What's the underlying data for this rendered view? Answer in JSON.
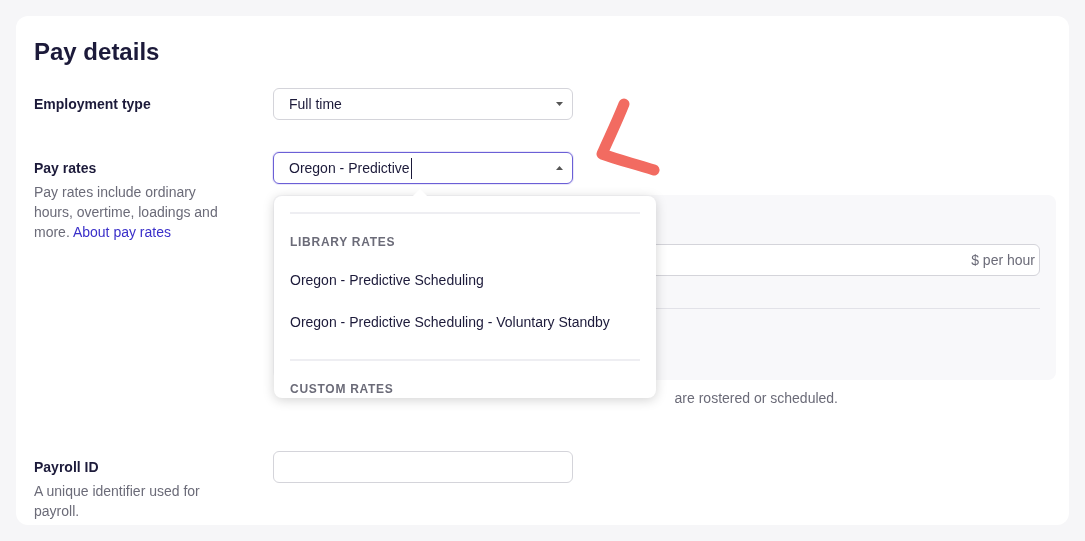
{
  "title": "Pay details",
  "employment_type": {
    "label": "Employment type",
    "value": "Full time"
  },
  "pay_rates": {
    "label": "Pay rates",
    "description": "Pay rates include ordinary hours, overtime, loadings and more.",
    "link": "About pay rates",
    "value": "Oregon - Predictive",
    "expanded": true,
    "panel": {
      "rate_suffix": "$ per hour"
    },
    "area_note": "are rostered or scheduled.",
    "dropdown": {
      "groups": [
        {
          "heading": "LIBRARY RATES",
          "items": [
            {
              "label": "Oregon - Predictive Scheduling"
            },
            {
              "label": "Oregon - Predictive Scheduling - Voluntary Standby"
            }
          ]
        },
        {
          "heading": "CUSTOM RATES"
        }
      ]
    }
  },
  "payroll_id": {
    "label": "Payroll ID",
    "description": "A unique identifier used for payroll."
  }
}
